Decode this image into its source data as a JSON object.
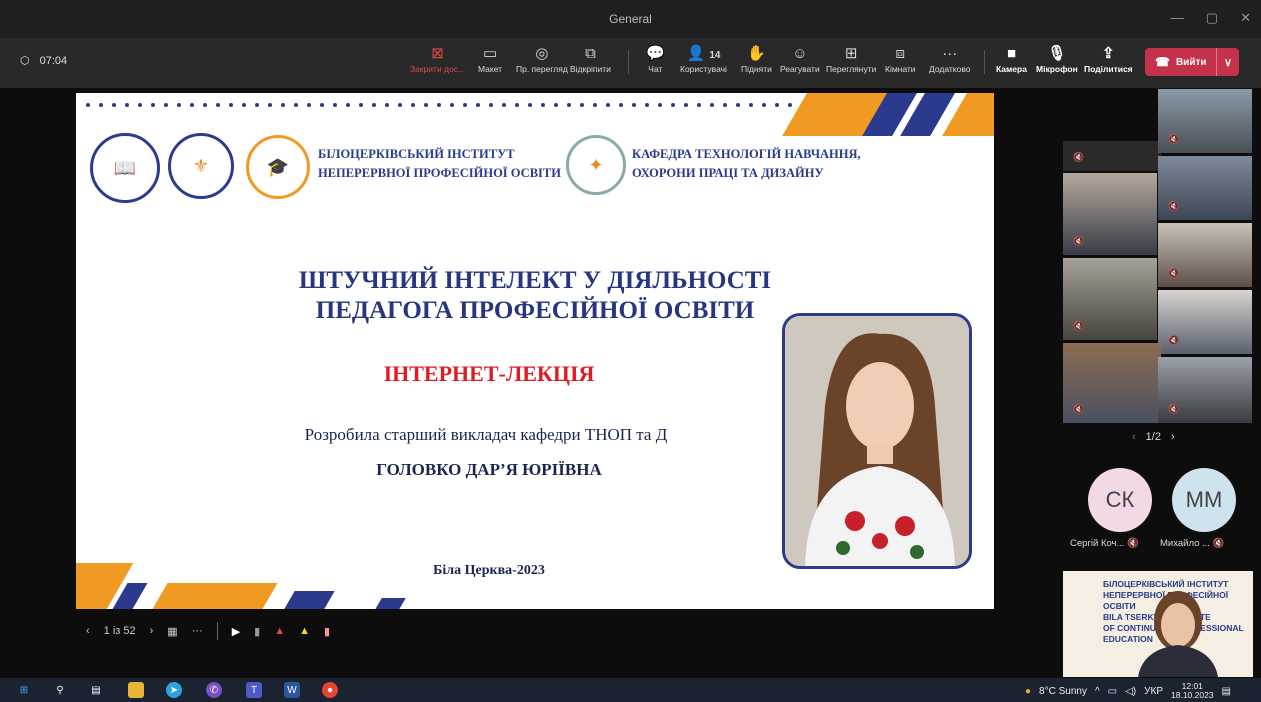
{
  "window": {
    "title": "General"
  },
  "toolbar": {
    "timer": "07:04",
    "buttons": [
      {
        "label": "Закрити дос...",
        "icon": "close-share-icon"
      },
      {
        "label": "Макет",
        "icon": "layout-icon"
      },
      {
        "label": "Пр. перегляд",
        "icon": "view-icon"
      },
      {
        "label": "Відкріпити",
        "icon": "pop-out-icon"
      },
      {
        "label": "Чат",
        "icon": "chat-icon"
      },
      {
        "label": "Користувачі",
        "icon": "people-icon",
        "count": "14"
      },
      {
        "label": "Підняти",
        "icon": "raise-hand-icon"
      },
      {
        "label": "Реагувати",
        "icon": "react-icon"
      },
      {
        "label": "Переглянути",
        "icon": "view-grid-icon"
      },
      {
        "label": "Кімнати",
        "icon": "rooms-icon"
      },
      {
        "label": "Додатково",
        "icon": "more-icon"
      },
      {
        "label": "Камера",
        "icon": "camera-icon"
      },
      {
        "label": "Мікрофон",
        "icon": "mic-icon"
      },
      {
        "label": "Поділитися",
        "icon": "share-icon"
      }
    ],
    "leave_label": "Вийти"
  },
  "slide": {
    "org1": [
      "БІЛОЦЕРКІВСЬКИЙ ІНСТИТУТ",
      "НЕПЕРЕРВНОЇ ПРОФЕСІЙНОЇ ОСВІТИ"
    ],
    "org2": [
      "КАФЕДРА ТЕХНОЛОГІЙ НАВЧАННЯ,",
      "ОХОРОНИ ПРАЦІ ТА ДИЗАЙНУ"
    ],
    "title_line1": "ШТУЧНИЙ ІНТЕЛЕКТ У ДІЯЛЬНОСТІ",
    "title_line2": "ПЕДАГОГА ПРОФЕСІЙНОЇ ОСВІТИ",
    "lecture": "ІНТЕРНЕТ-ЛЕКЦІЯ",
    "author": "Розробила старший викладач кафедри ТНОП та Д",
    "name": "ГОЛОВКО ДАР’Я ЮРІЇВНА",
    "city_year": "Біла Церква-2023"
  },
  "presenter": {
    "page": "1 із 52"
  },
  "participants": {
    "pager": "1/2",
    "avatars": [
      {
        "initials": "СК",
        "name": "Сергій Коч...",
        "color": "#f3d9e6"
      },
      {
        "initials": "ММ",
        "name": "Михайло ...",
        "color": "#cfe3ee"
      }
    ]
  },
  "presenter_tile": {
    "line1": "БІЛОЦЕРКІВСЬКИЙ ІНСТИТУТ",
    "line2": "НЕПЕРЕРВНОЇ ПРОФЕСІЙНОЇ ОСВІТИ",
    "line3": "BILA TSERKVA INSTITUTE",
    "line4": "OF CONTINUOUS PROFESSIONAL",
    "line5": "EDUCATION"
  },
  "taskbar": {
    "weather": "8°C Sunny",
    "lang": "УКР",
    "time": "12:01",
    "date": "18.10.2023"
  },
  "colors": {
    "accent_red": "#c4314b",
    "slide_blue": "#2b3a8c",
    "slide_orange": "#f09a23",
    "lecture_red": "#e11b22"
  }
}
